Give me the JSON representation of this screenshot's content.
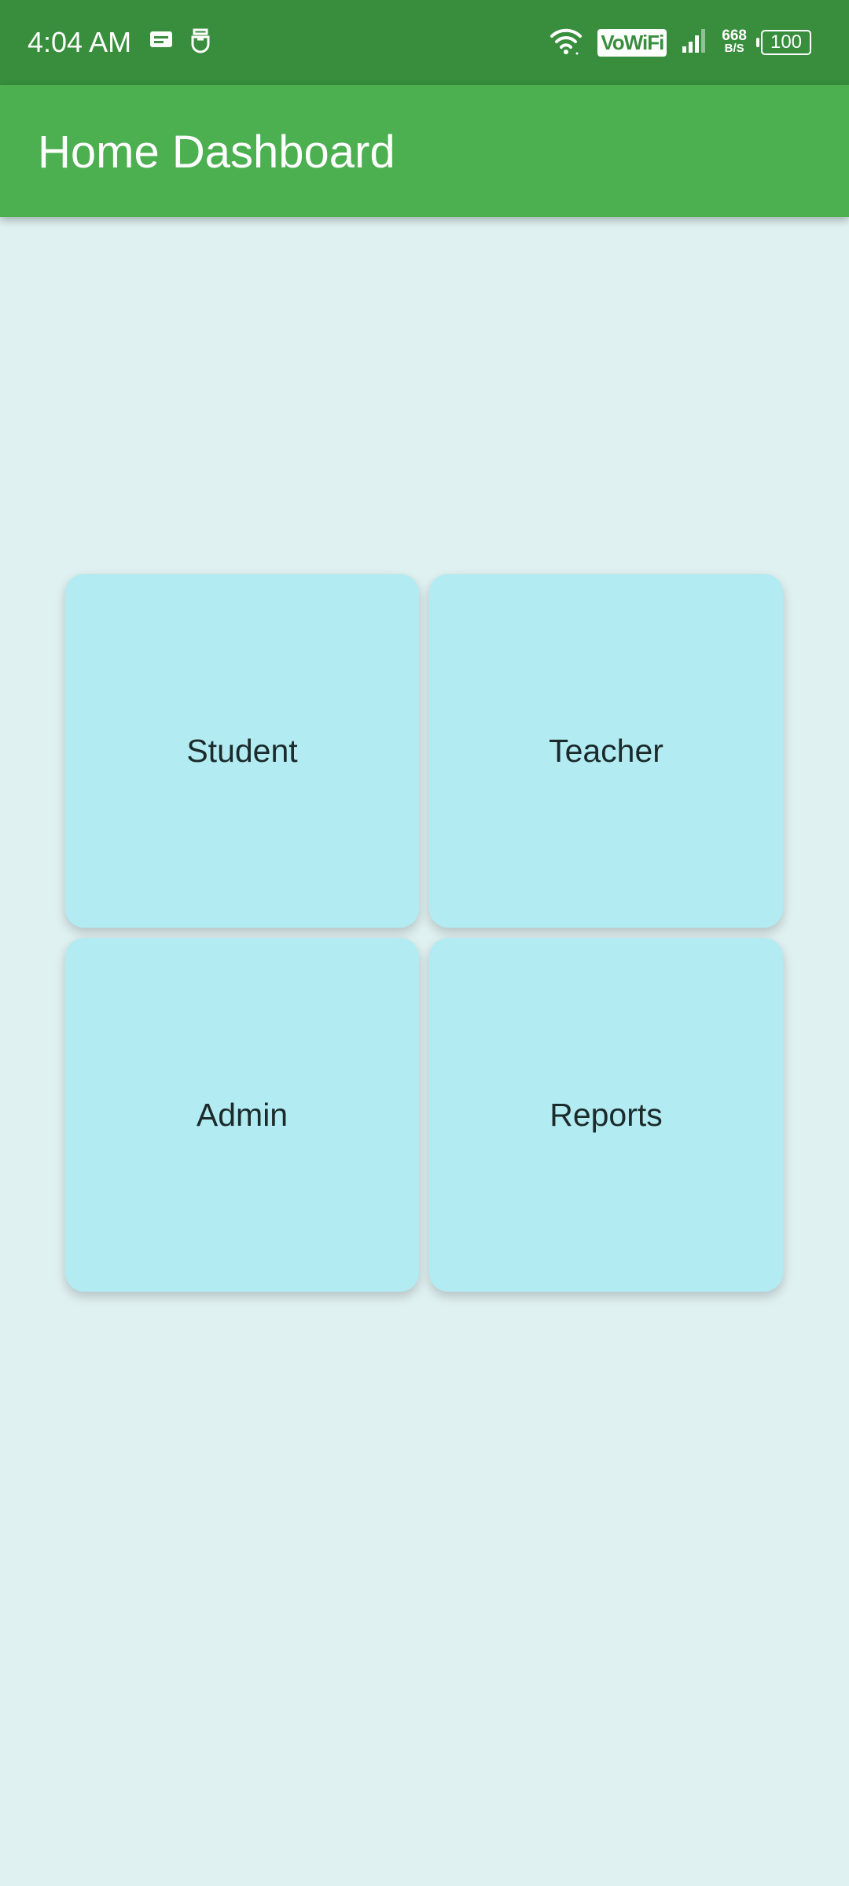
{
  "status_bar": {
    "time": "4:04 AM",
    "left_icons": [
      "message-icon",
      "notification-app-icon"
    ],
    "vowifi": "VoWiFi",
    "net_speed_value": "668",
    "net_speed_unit": "B/S",
    "battery": "100",
    "color": "#388e3c"
  },
  "app_bar": {
    "title": "Home Dashboard",
    "color": "#4caf50"
  },
  "dashboard": {
    "tile_color": "#b2ebf2",
    "background": "#e0f1f1",
    "tiles": [
      {
        "label": "Student"
      },
      {
        "label": "Teacher"
      },
      {
        "label": "Admin"
      },
      {
        "label": "Reports"
      }
    ]
  }
}
